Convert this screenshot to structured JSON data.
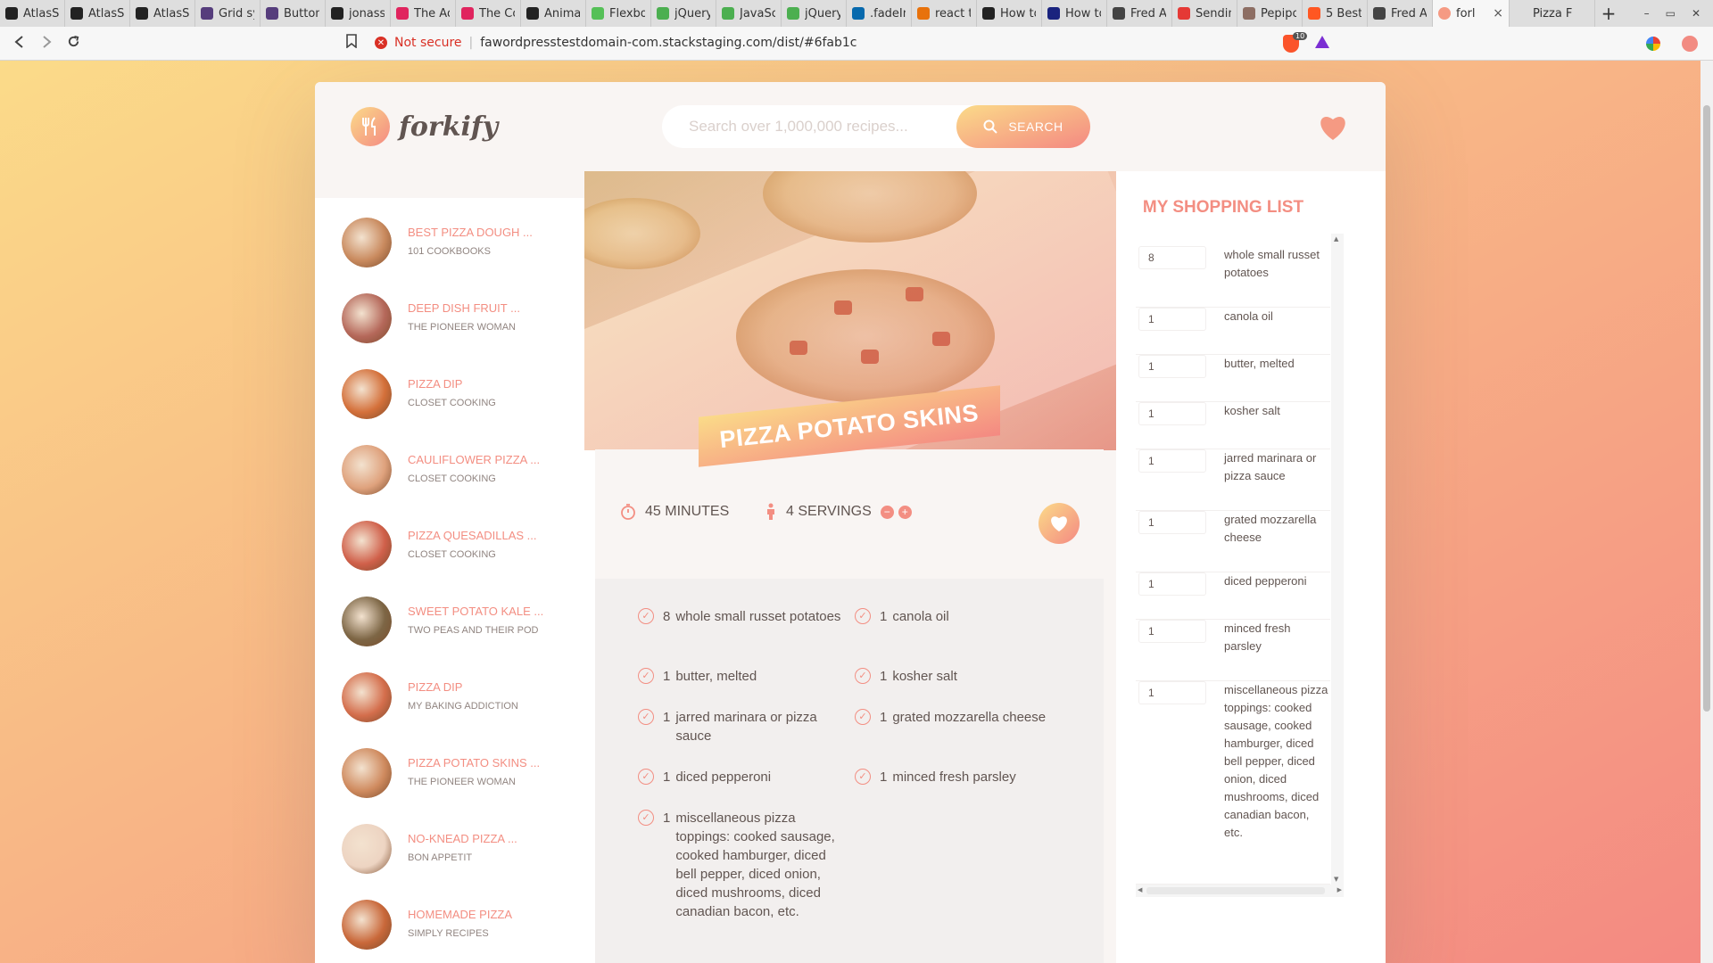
{
  "browser": {
    "tabs": [
      {
        "label": "AtlasS",
        "icon": "github-icon",
        "color": "#222222"
      },
      {
        "label": "AtlasS",
        "icon": "github-icon",
        "color": "#222222"
      },
      {
        "label": "AtlasS",
        "icon": "github-icon",
        "color": "#222222"
      },
      {
        "label": "Grid sy",
        "icon": "bootstrap-icon",
        "color": "#563d7c"
      },
      {
        "label": "Button",
        "icon": "bootstrap-icon",
        "color": "#563d7c"
      },
      {
        "label": "jonass",
        "icon": "github-icon",
        "color": "#222222"
      },
      {
        "label": "The Ad",
        "icon": "react-icon",
        "color": "#e0245e"
      },
      {
        "label": "The Co",
        "icon": "react-icon",
        "color": "#e0245e"
      },
      {
        "label": "Animat",
        "icon": "codepen-icon",
        "color": "#222222"
      },
      {
        "label": "Flexbo",
        "icon": "css-icon",
        "color": "#55c057"
      },
      {
        "label": "jQuery",
        "icon": "w3-icon",
        "color": "#4caf50"
      },
      {
        "label": "JavaSc",
        "icon": "w3-icon",
        "color": "#4caf50"
      },
      {
        "label": "jQuery",
        "icon": "w3-icon",
        "color": "#4caf50"
      },
      {
        "label": ".fadeIn",
        "icon": "jquery-icon",
        "color": "#0769ad"
      },
      {
        "label": "react t",
        "icon": "stackoverflow-icon",
        "color": "#e8720c"
      },
      {
        "label": "How to",
        "icon": "medium-icon",
        "color": "#222222"
      },
      {
        "label": "How to",
        "icon": "site-icon",
        "color": "#1a237e"
      },
      {
        "label": "Fred A",
        "icon": "globe-icon",
        "color": "#444444"
      },
      {
        "label": "Sendin",
        "icon": "target-icon",
        "color": "#e53935"
      },
      {
        "label": "Pepipo",
        "icon": "avatar-icon",
        "color": "#8d6e63"
      },
      {
        "label": "5 Best",
        "icon": "blogger-icon",
        "color": "#ff5722"
      },
      {
        "label": "Fred A",
        "icon": "globe-icon",
        "color": "#444444"
      }
    ],
    "active_tab": {
      "label": "forl",
      "close": "×"
    },
    "last_tab": {
      "label": "Pizza F"
    },
    "new_tab": "+",
    "window_controls": [
      "–",
      "▭",
      "✕"
    ],
    "security_label": "Not secure",
    "url": "fawordpresstestdomain-com.stackstaging.com/dist/#6fab1c",
    "brave_badge": "10"
  },
  "header": {
    "logo_text": "forkify",
    "search_placeholder": "Search over 1,000,000 recipes...",
    "search_button": "SEARCH"
  },
  "results": [
    {
      "title": "BEST PIZZA DOUGH ...",
      "author": "101 COOKBOOKS",
      "color": "#c98a5e"
    },
    {
      "title": "DEEP DISH FRUIT ...",
      "author": "THE PIONEER WOMAN",
      "color": "#b5685a"
    },
    {
      "title": "PIZZA DIP",
      "author": "CLOSET COOKING",
      "color": "#d4703a"
    },
    {
      "title": "CAULIFLOWER PIZZA ...",
      "author": "CLOSET COOKING",
      "color": "#dfa27d"
    },
    {
      "title": "PIZZA QUESADILLAS ...",
      "author": "CLOSET COOKING",
      "color": "#d0604a"
    },
    {
      "title": "SWEET POTATO KALE ...",
      "author": "TWO PEAS AND THEIR POD",
      "color": "#7d6645"
    },
    {
      "title": "PIZZA DIP",
      "author": "MY BAKING ADDICTION",
      "color": "#d46e4c"
    },
    {
      "title": "PIZZA POTATO SKINS ...",
      "author": "THE PIONEER WOMAN",
      "color": "#cf8a5e"
    },
    {
      "title": "NO-KNEAD PIZZA ...",
      "author": "BON APPETIT",
      "color": "#edd4c2"
    },
    {
      "title": "HOMEMADE PIZZA",
      "author": "SIMPLY RECIPES",
      "color": "#c9683a"
    }
  ],
  "recipe": {
    "title": "PIZZA POTATO SKINS",
    "time": "45",
    "time_unit": "MINUTES",
    "servings": "4",
    "servings_unit": "SERVINGS",
    "ingredients": [
      {
        "count": "8",
        "desc": "whole small russet potatoes"
      },
      {
        "count": "1",
        "desc": "canola oil"
      },
      {
        "count": "1",
        "desc": "butter, melted"
      },
      {
        "count": "1",
        "desc": "kosher salt"
      },
      {
        "count": "1",
        "desc": "jarred marinara or pizza sauce"
      },
      {
        "count": "1",
        "desc": "grated mozzarella cheese"
      },
      {
        "count": "1",
        "desc": "diced pepperoni"
      },
      {
        "count": "1",
        "desc": "minced fresh parsley"
      },
      {
        "count": "1",
        "desc": "miscellaneous pizza toppings: cooked sausage, cooked hamburger, diced bell pepper, diced onion, diced mushrooms, diced canadian bacon, etc."
      }
    ]
  },
  "shopping": {
    "title": "MY SHOPPING LIST",
    "items": [
      {
        "count": "8",
        "desc": "whole small russet potatoes"
      },
      {
        "count": "1",
        "desc": "canola oil"
      },
      {
        "count": "1",
        "desc": "butter, melted"
      },
      {
        "count": "1",
        "desc": "kosher salt"
      },
      {
        "count": "1",
        "desc": "jarred marinara or pizza sauce"
      },
      {
        "count": "1",
        "desc": "grated mozzarella cheese"
      },
      {
        "count": "1",
        "desc": "diced pepperoni"
      },
      {
        "count": "1",
        "desc": "minced fresh parsley"
      },
      {
        "count": "1",
        "desc": "miscellaneous pizza toppings: cooked sausage, cooked hamburger, diced bell pepper, diced onion, diced mushrooms, diced canadian bacon, etc."
      }
    ]
  },
  "colors": {
    "accent": "#f38e82",
    "gradient_start": "#fbdb89",
    "gradient_end": "#f48982",
    "text": "#615551"
  }
}
